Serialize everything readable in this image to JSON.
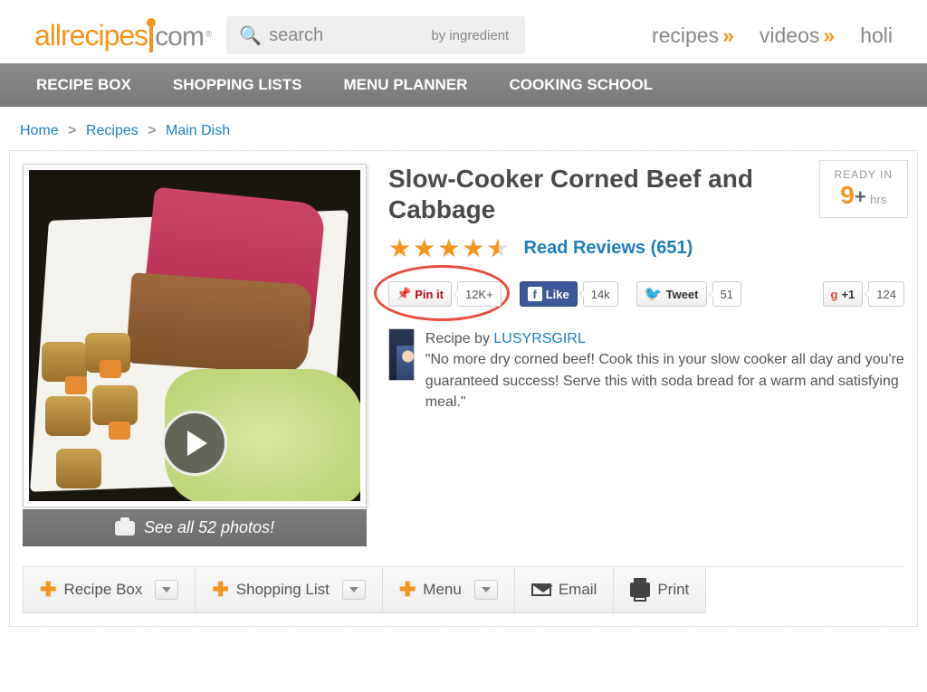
{
  "logo": {
    "part1": "allrecipes",
    "part2": "com"
  },
  "search": {
    "placeholder": "search",
    "mode": "by ingredient"
  },
  "topnav": [
    {
      "label": "recipes"
    },
    {
      "label": "videos"
    },
    {
      "label": "holi"
    }
  ],
  "graynav": [
    "RECIPE BOX",
    "SHOPPING LISTS",
    "MENU PLANNER",
    "COOKING SCHOOL"
  ],
  "breadcrumbs": [
    {
      "label": "Home"
    },
    {
      "label": "Recipes"
    },
    {
      "label": "Main Dish"
    }
  ],
  "recipe": {
    "title": "Slow-Cooker Corned Beef and Cabbage",
    "rating": 4.5,
    "reviews_label": "Read Reviews",
    "reviews_count": "(651)",
    "ready_label": "READY IN",
    "ready_value": "9",
    "ready_plus": "+",
    "ready_unit": "hrs",
    "photos_link": "See all 52 photos!",
    "author_prefix": "Recipe by ",
    "author": "LUSYRSGIRL",
    "description": "\"No more dry corned beef! Cook this in your slow cooker all day and you're guaranteed success! Serve this with soda bread for a warm and satisfying meal.\""
  },
  "social": {
    "pinit": {
      "label": "Pin it",
      "count": "12K+"
    },
    "like": {
      "label": "Like",
      "count": "14k"
    },
    "tweet": {
      "label": "Tweet",
      "count": "51"
    },
    "gplus": {
      "label": "+1",
      "count": "124"
    }
  },
  "actions": {
    "recipebox": "Recipe Box",
    "shoppinglist": "Shopping List",
    "menu": "Menu",
    "email": "Email",
    "print": "Print"
  }
}
